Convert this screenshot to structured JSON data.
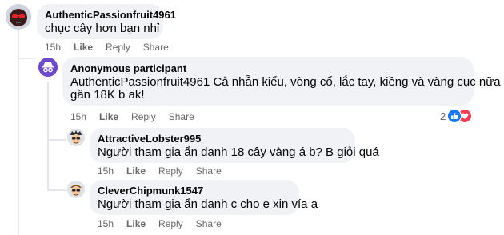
{
  "comments": [
    {
      "author": "AuthenticPassionfruit4961",
      "lines": [
        "chục cây hơn bạn nhỉ"
      ],
      "time": "15h",
      "like": "Like",
      "reply": "Reply",
      "share": "Share",
      "avatar_icon": "sunglasses-avatar-icon"
    },
    {
      "author": "Anonymous participant",
      "lines": [
        "AuthenticPassionfruit4961 Cả nhẫn kiểu, vòng cổ, lắc tay, kiềng và vàng cục nữa thì",
        "gần 18K b ak!"
      ],
      "time": "15h",
      "like": "Like",
      "reply": "Reply",
      "share": "Share",
      "reaction_count": "2",
      "reaction_icons": [
        "like-reaction-icon",
        "love-reaction-icon"
      ],
      "avatar_icon": "anonymous-avatar-icon"
    },
    {
      "author": "AttractiveLobster995",
      "lines": [
        "Người tham gia ẩn danh 18 cây vàng á b? B giỏi quá"
      ],
      "time": "15h",
      "like": "Like",
      "reply": "Reply",
      "share": "Share",
      "avatar_icon": "cartoon-avatar-icon"
    },
    {
      "author": "CleverChipmunk1547",
      "lines": [
        "Người tham gia ẩn danh c cho e xin vía ạ"
      ],
      "time": "15h",
      "like": "Like",
      "reply": "Reply",
      "share": "Share",
      "avatar_icon": "cartoon-avatar-icon"
    }
  ],
  "colors": {
    "bubble": "#f0f2f5",
    "meta": "#65676b",
    "like_blue": "#1877f2",
    "love_red": "#f33e58",
    "anon_purple": "#6e49c7"
  }
}
